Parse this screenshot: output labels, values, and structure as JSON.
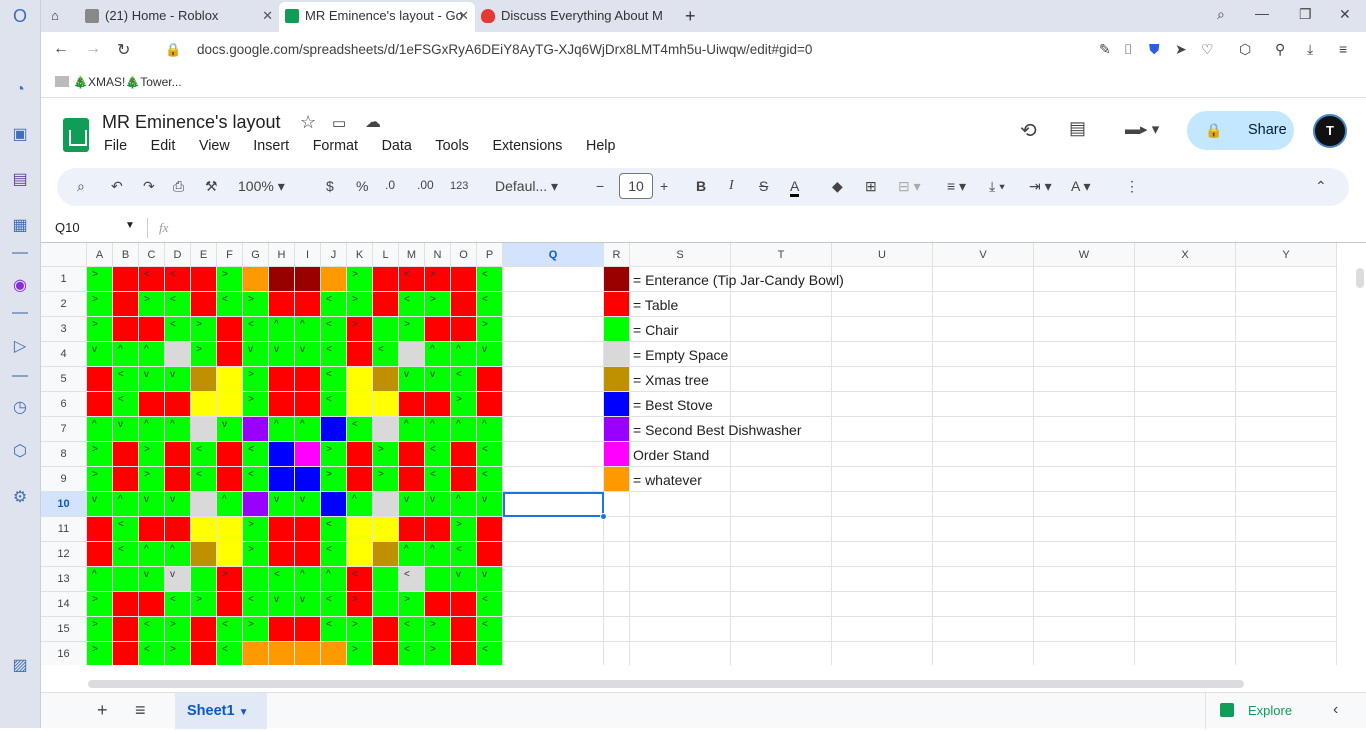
{
  "browser": {
    "tabs": [
      {
        "title": "(21) Home - Roblox",
        "icon": "roblox-icon",
        "active": false
      },
      {
        "title": "MR Eminence's layout - Go",
        "icon": "sheets-icon",
        "active": true
      },
      {
        "title": "Discuss Everything About M",
        "icon": "fire-icon",
        "active": false
      }
    ],
    "url": "docs.google.com/spreadsheets/d/1eFSGxRyA6DEiY8AyTG-XJq6WjDrx8LMT4mh5u-Uiwqw/edit#gid=0",
    "bookmark": "🎄XMAS!🎄Tower..."
  },
  "app": {
    "title": "MR Eminence's layout",
    "menus": [
      "File",
      "Edit",
      "View",
      "Insert",
      "Format",
      "Data",
      "Tools",
      "Extensions",
      "Help"
    ],
    "share_label": "Share",
    "avatar_letter": "T"
  },
  "toolbar": {
    "zoom": "100%",
    "currency": "$",
    "percent": "%",
    "dec_decrease": ".0",
    "dec_increase": ".00",
    "number_format": "123",
    "font": "Defaul...",
    "font_size": "10"
  },
  "formula": {
    "cell_ref": "Q10",
    "fx": "fx"
  },
  "columns": [
    "A",
    "B",
    "C",
    "D",
    "E",
    "F",
    "G",
    "H",
    "I",
    "J",
    "K",
    "L",
    "M",
    "N",
    "O",
    "P",
    "Q",
    "R",
    "S",
    "T",
    "U",
    "V",
    "W",
    "X",
    "Y"
  ],
  "rows": [
    "1",
    "2",
    "3",
    "4",
    "5",
    "6",
    "7",
    "8",
    "9",
    "10",
    "11",
    "12",
    "13",
    "14",
    "15",
    "16"
  ],
  "selected": {
    "col": "Q",
    "row": "10"
  },
  "colors": {
    "G": "#00ff00",
    "R": "#ff0000",
    "Y": "#ffff00",
    "E": "#d9d9d9",
    "D": "#980000",
    "O": "#ff9900",
    "B": "#0000ff",
    "P": "#9900ff",
    "M": "#ff00ff",
    "X": "#bf9000"
  },
  "grid_colors": [
    "GRRRRGODDOGRRRRG",
    "GRGGRGGRRGGRGGRG",
    "GRRGGRGGGGRGGRRG",
    "GGGEGRGGGGRGEGGG",
    "RGGGXYGRRGYXGGGR",
    "RGRRYYGRRGYYRRGR",
    "GGGGEGPGGBGEGGGG",
    "GRGRGRGBMGRGRGRG",
    "GRGRGRGBBGRGRGRG",
    "GGGGEGPGGBGEGGGG",
    "RGRRYYGRRGYYRRGR",
    "RGGGXYGRRGYXGGGR",
    "GGGEGRGGGGRGEGGG",
    "GRRGGRGGGGRGGRRG",
    "GRGGRGGRRGGRGGRG",
    "GRGGRGOOOOGRGGRG"
  ],
  "grid_text": [
    [
      ">",
      "",
      "<",
      "<",
      "",
      ">",
      "",
      "",
      "",
      "",
      ">",
      "",
      "<",
      ">",
      "",
      "<"
    ],
    [
      ">",
      "",
      ">",
      "<",
      "",
      "<",
      ">",
      "",
      "",
      "<",
      ">",
      "",
      "<",
      ">",
      "",
      "<"
    ],
    [
      ">",
      "",
      "",
      "<",
      ">",
      "",
      "<",
      "^",
      "^",
      "<",
      ">",
      "",
      ">",
      "",
      "",
      ">"
    ],
    [
      "v",
      "^",
      "^",
      "",
      ">",
      "",
      "v",
      "v",
      "v",
      "<",
      "",
      "<",
      "",
      "^",
      "^",
      "v"
    ],
    [
      "",
      "<",
      "v",
      "v",
      "",
      "",
      ">",
      "",
      "",
      "<",
      "",
      "",
      "v",
      "v",
      "<",
      ""
    ],
    [
      "",
      "<",
      "",
      "",
      "",
      "",
      ">",
      "",
      "",
      "<",
      "",
      "",
      "",
      "",
      ">",
      ""
    ],
    [
      "^",
      "v",
      "^",
      "^",
      "",
      "v",
      "",
      "^",
      "^",
      "",
      "<",
      "",
      "^",
      "^",
      "^",
      "^"
    ],
    [
      ">",
      "",
      ">",
      "",
      "<",
      "",
      "<",
      "",
      "",
      ">",
      "",
      ">",
      "",
      "<",
      "",
      "<"
    ],
    [
      ">",
      "",
      ">",
      "",
      "<",
      "",
      "<",
      "",
      "",
      ">",
      "",
      ">",
      "",
      "<",
      "",
      "<"
    ],
    [
      "v",
      "^",
      "v",
      "v",
      "",
      "^",
      "",
      "v",
      "v",
      "",
      "^",
      "",
      "v",
      "v",
      "^",
      "v"
    ],
    [
      "",
      "<",
      "",
      "",
      "",
      "",
      ">",
      "",
      "",
      "<",
      "",
      "",
      "",
      "",
      ">",
      ""
    ],
    [
      "",
      "<",
      "^",
      "^",
      "",
      "",
      ">",
      "",
      "",
      "<",
      "",
      "",
      "^",
      "^",
      "<",
      ""
    ],
    [
      "^",
      "",
      "v",
      "v",
      "",
      ">",
      "",
      "<",
      "^",
      "^",
      "<",
      "",
      "<",
      "",
      "v",
      "v",
      "^"
    ],
    [
      ">",
      "",
      "",
      "<",
      ">",
      "",
      "<",
      "v",
      "v",
      "<",
      ">",
      "",
      ">",
      "",
      "",
      "<"
    ],
    [
      ">",
      "",
      "<",
      ">",
      "",
      "<",
      ">",
      "",
      "",
      "<",
      ">",
      "",
      "<",
      ">",
      "",
      "<"
    ],
    [
      ">",
      "",
      "<",
      ">",
      "",
      "<",
      "",
      "",
      "",
      "",
      ">",
      "",
      "<",
      ">",
      "",
      "<"
    ]
  ],
  "legend": [
    {
      "color": "#980000",
      "text": "= Enterance (Tip Jar-Candy Bowl)"
    },
    {
      "color": "#ff0000",
      "text": "= Table"
    },
    {
      "color": "#00ff00",
      "text": "= Chair"
    },
    {
      "color": "#d9d9d9",
      "text": "= Empty Space"
    },
    {
      "color": "#bf9000",
      "text": "= Xmas tree"
    },
    {
      "color": "#0000ff",
      "text": "= Best Stove"
    },
    {
      "color": "#9900ff",
      "text": "= Second Best Dishwasher"
    },
    {
      "color": "#ff00ff",
      "text": "Order Stand"
    },
    {
      "color": "#ff9900",
      "text": "= whatever"
    }
  ],
  "sheets": {
    "active": "Sheet1",
    "explore_label": "Explore"
  }
}
